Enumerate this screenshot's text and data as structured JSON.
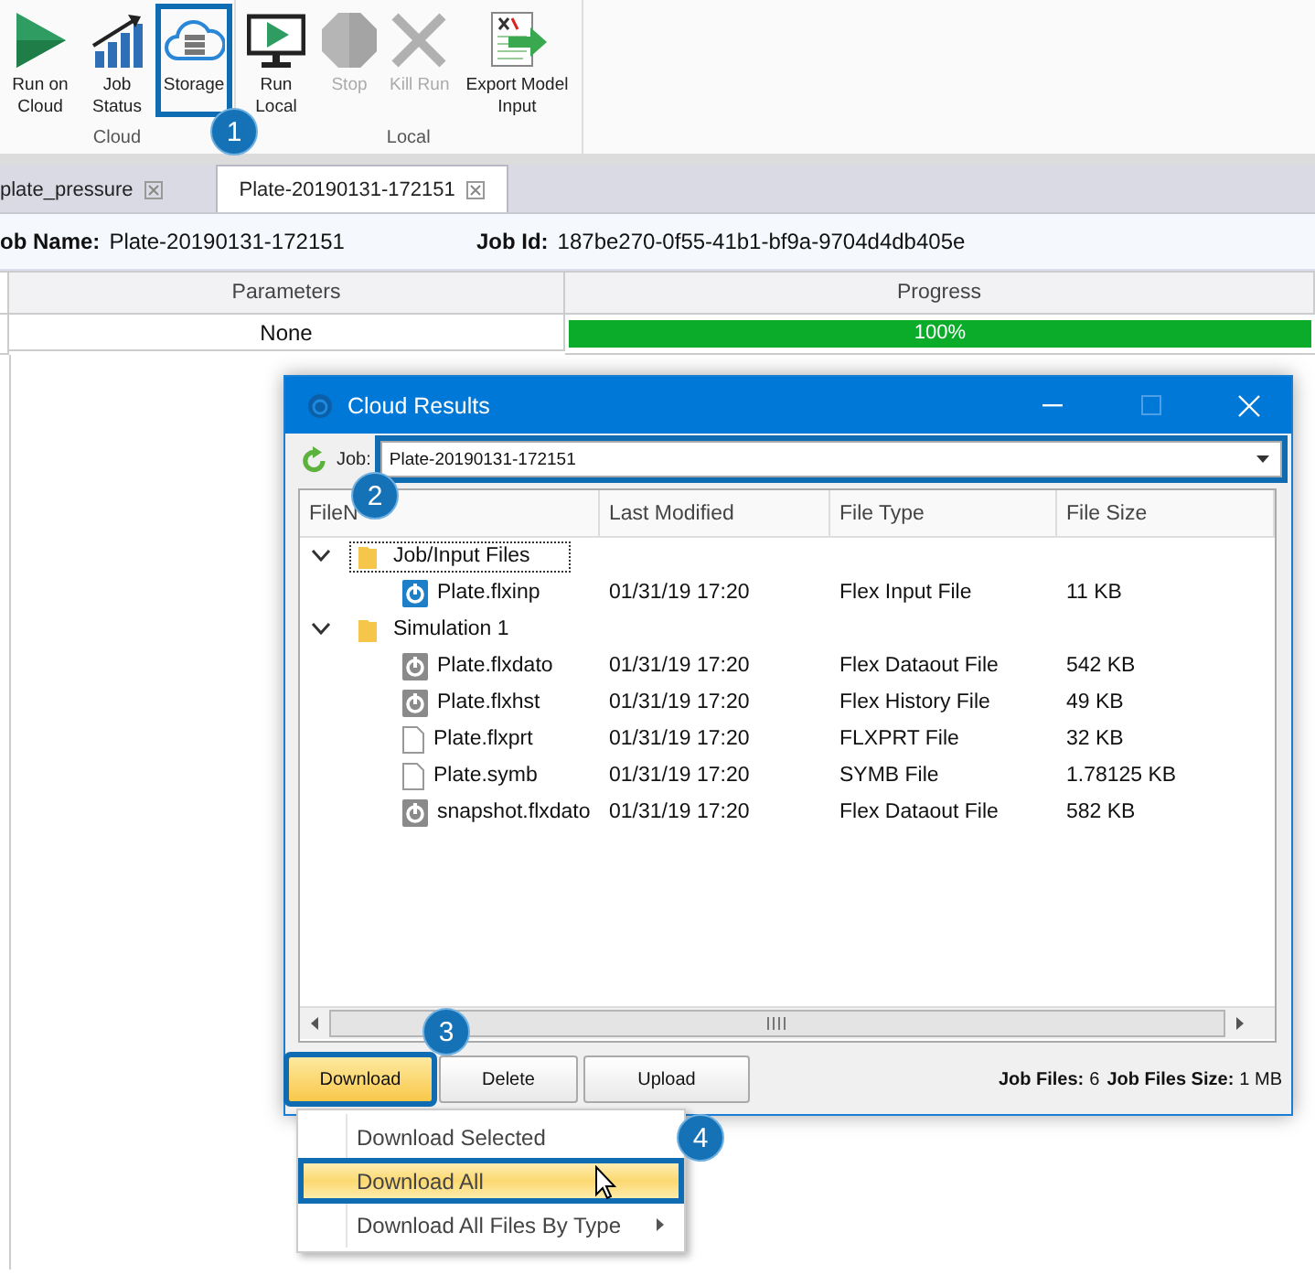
{
  "ribbon": {
    "groups": [
      {
        "label": "Cloud",
        "buttons": [
          {
            "kind": "run",
            "label": "Run on Cloud",
            "disabled": false,
            "highlighted": false
          },
          {
            "kind": "status",
            "label": "Job Status",
            "disabled": false,
            "highlighted": false
          },
          {
            "kind": "storage",
            "label": "Storage",
            "disabled": false,
            "highlighted": true
          }
        ]
      },
      {
        "label": "Local",
        "buttons": [
          {
            "kind": "local",
            "label": "Run Local",
            "disabled": false,
            "highlighted": false
          },
          {
            "kind": "stop",
            "label": "Stop",
            "disabled": true,
            "highlighted": false
          },
          {
            "kind": "kill",
            "label": "Kill Run",
            "disabled": true,
            "highlighted": false
          },
          {
            "kind": "export",
            "label": "Export Model Input",
            "disabled": false,
            "highlighted": false
          }
        ]
      }
    ]
  },
  "tabs": [
    {
      "label": "plate_pressure",
      "selected": false
    },
    {
      "label": "Plate-20190131-172151",
      "selected": true
    }
  ],
  "job_info": {
    "name_label": "ob Name:",
    "name": "Plate-20190131-172151",
    "id_label": "Job Id:",
    "id": "187be270-0f55-41b1-bf9a-9704d4db405e"
  },
  "table": {
    "columns": [
      "Parameters",
      "Progress"
    ],
    "rows": [
      {
        "parameters": "None",
        "progress": {
          "level": 1,
          "reading": "100%"
        }
      }
    ]
  },
  "dialog": {
    "title": "Cloud Results",
    "job_label": "Job:",
    "job": {
      "value": "Plate-20190131-172151",
      "highlighted": true
    },
    "columns": [
      "FileN",
      "Last Modified",
      "File Type",
      "File Size"
    ],
    "tree": [
      {
        "name": "Job/Input Files",
        "expanded": true,
        "focused": true,
        "children": [
          {
            "kind": "input",
            "name": "Plate.flxinp",
            "modified": "01/31/19 17:20",
            "type": "Flex Input File",
            "size": "11 KB"
          }
        ]
      },
      {
        "name": "Simulation 1",
        "expanded": true,
        "focused": false,
        "children": [
          {
            "kind": "output",
            "name": "Plate.flxdato",
            "modified": "01/31/19 17:20",
            "type": "Flex Dataout File",
            "size": "542 KB"
          },
          {
            "kind": "output",
            "name": "Plate.flxhst",
            "modified": "01/31/19 17:20",
            "type": "Flex History File",
            "size": "49 KB"
          },
          {
            "kind": "text",
            "name": "Plate.flxprt",
            "modified": "01/31/19 17:20",
            "type": "FLXPRT File",
            "size": "32 KB"
          },
          {
            "kind": "text",
            "name": "Plate.symb",
            "modified": "01/31/19 17:20",
            "type": "SYMB File",
            "size": "1.78125 KB"
          },
          {
            "kind": "output",
            "name": "snapshot.flxdato",
            "modified": "01/31/19 17:20",
            "type": "Flex Dataout File",
            "size": "582 KB"
          }
        ]
      }
    ],
    "buttons": [
      {
        "label": "Download",
        "pressed": true,
        "highlighted": true
      },
      {
        "label": "Delete",
        "pressed": false,
        "highlighted": false
      },
      {
        "label": "Upload",
        "pressed": false,
        "highlighted": false
      }
    ],
    "status": [
      {
        "label": "Job Files:",
        "value": "6"
      },
      {
        "label": "Job Files Size:",
        "value": "1 MB"
      }
    ]
  },
  "menu": {
    "items": [
      {
        "label": "Download Selected",
        "selected": false,
        "highlighted": false,
        "submenu": false
      },
      {
        "label": "Download All",
        "selected": true,
        "highlighted": true,
        "submenu": false
      },
      {
        "label": "Download All Files By Type",
        "selected": false,
        "highlighted": false,
        "submenu": true
      }
    ]
  },
  "callouts": [
    "1",
    "2",
    "3",
    "4"
  ]
}
